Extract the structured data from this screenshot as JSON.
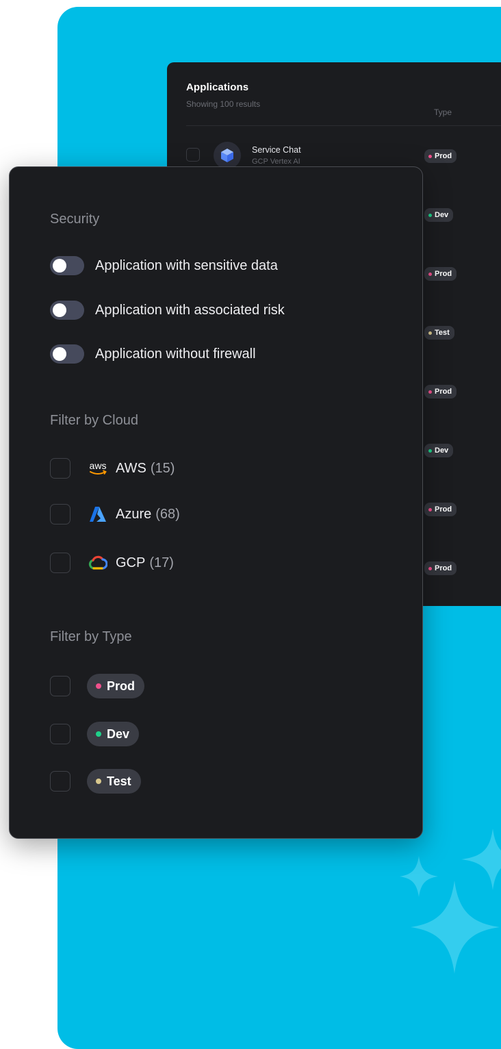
{
  "colors": {
    "background_panel": "#00bde6",
    "card": "#1b1c1f",
    "prod": "#f0508c",
    "dev": "#1fd18a",
    "test": "#d8c88e",
    "toggle_track": "#464a5c"
  },
  "applications": {
    "title": "Applications",
    "subtitle": "Showing 100 results",
    "column_type": "Type",
    "rows": [
      {
        "name": "Service Chat",
        "provider": "GCP Vertex AI",
        "type": "Prod",
        "icon": "cube-icon"
      },
      {
        "type": "Dev"
      },
      {
        "type": "Prod"
      },
      {
        "type": "Test"
      },
      {
        "type": "Prod"
      },
      {
        "type": "Dev"
      },
      {
        "type": "Prod"
      },
      {
        "type": "Prod"
      }
    ]
  },
  "filters": {
    "security": {
      "title": "Security",
      "toggles": [
        {
          "label": "Application with sensitive data",
          "on": false
        },
        {
          "label": "Application with associated risk",
          "on": false
        },
        {
          "label": "Application without firewall",
          "on": false
        }
      ]
    },
    "cloud": {
      "title": "Filter by Cloud",
      "options": [
        {
          "name": "AWS",
          "count": "(15)",
          "icon": "aws-logo-icon"
        },
        {
          "name": "Azure",
          "count": "(68)",
          "icon": "azure-logo-icon"
        },
        {
          "name": "GCP",
          "count": "(17)",
          "icon": "gcp-logo-icon"
        }
      ]
    },
    "type": {
      "title": "Filter by Type",
      "options": [
        {
          "label": "Prod"
        },
        {
          "label": "Dev"
        },
        {
          "label": "Test"
        }
      ]
    }
  }
}
